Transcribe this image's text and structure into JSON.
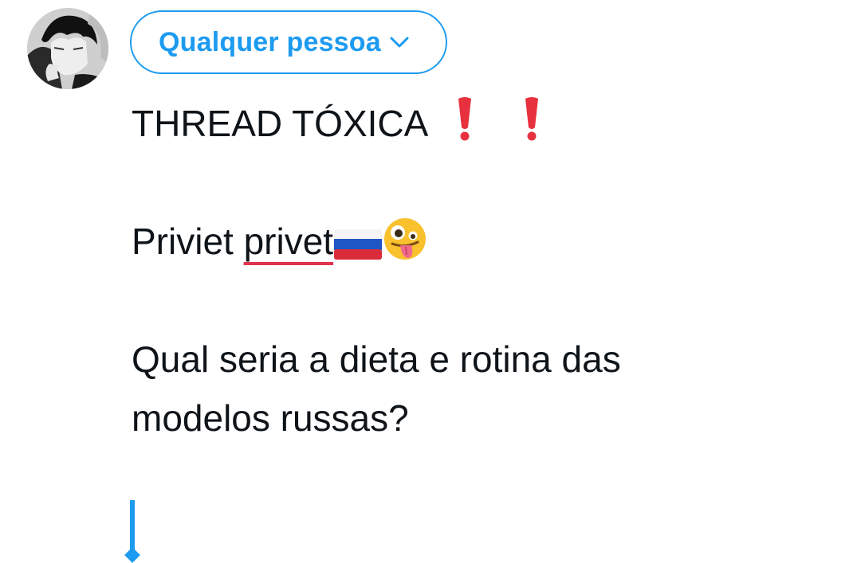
{
  "author": {
    "avatar_icon": "profile-avatar"
  },
  "audience": {
    "label": "Qualquer pessoa",
    "icon": "chevron-down-icon",
    "color": "#1d9bf0"
  },
  "composer": {
    "line1_text": "THREAD TÓXICA",
    "line1_icons": [
      "red-exclamation-icon",
      "red-exclamation-icon"
    ],
    "line2_word1": "Priviet",
    "line2_word2_misspelled": "privet",
    "line2_icons": [
      "russia-flag-icon",
      "zany-face-icon"
    ],
    "line3_text": "Qual seria a dieta e rotina das",
    "line4_text": "modelos russas?",
    "spellcheck_color": "#e0334d",
    "caret_color": "#1d9bf0"
  }
}
